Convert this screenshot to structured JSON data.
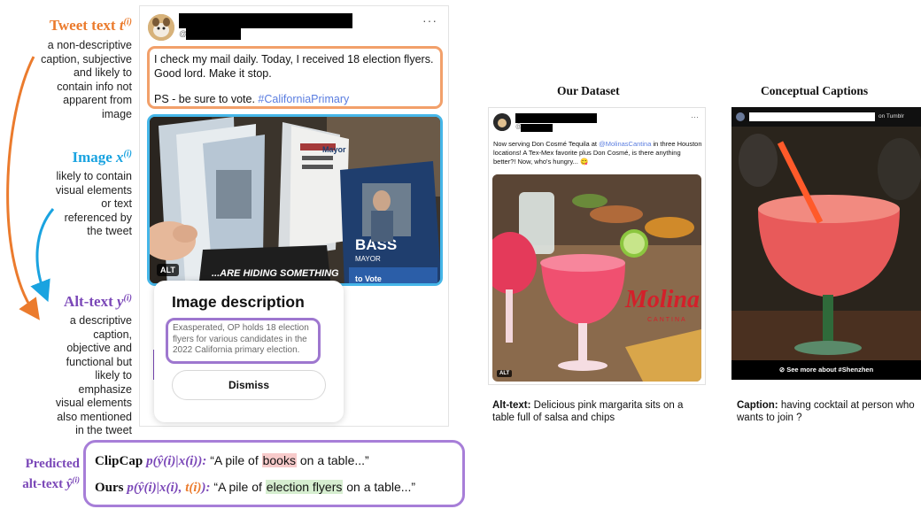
{
  "labels": {
    "tweet_text": {
      "title_prefix": "Tweet text",
      "symbol": "t",
      "superscript": "(i)",
      "description": "a non-descriptive caption, subjective and likely to contain info not apparent from image"
    },
    "image": {
      "title_prefix": "Image",
      "symbol": "x",
      "superscript": "(i)",
      "description": "likely to contain visual elements or text referenced by the tweet"
    },
    "alt_text": {
      "title_prefix": "Alt-text",
      "symbol": "y",
      "superscript": "(i)",
      "description": "a descriptive caption, objective and functional but likely to emphasize visual elements also mentioned in the tweet"
    },
    "predicted": {
      "line1": "Predicted",
      "line2": "alt-text",
      "symbol": "ŷ",
      "superscript": "(i)"
    }
  },
  "tweet": {
    "handle": "@",
    "more": "···",
    "text_line1": "I check my mail daily. Today, I received 18 election flyers.  Good lord. Make it stop.",
    "text_line2": "PS - be sure to vote. ",
    "hashtag": "#CaliforniaPrimary",
    "alt_badge": "ALT",
    "image_texts": [
      "...ARE HIDING SOMETHING",
      "BASS",
      "MAYOR",
      "to Vote",
      "Mayor"
    ]
  },
  "popup": {
    "title": "Image description",
    "description": "Exasperated, OP holds 18 election flyers for various candidates in the 2022 California primary election.",
    "dismiss": "Dismiss"
  },
  "predictions": {
    "clipcap": {
      "model": "ClipCap",
      "formula": "p(ŷ(i)|x(i)):",
      "quote_open": "“A pile of ",
      "highlight": "books",
      "quote_close": " on a table...”"
    },
    "ours": {
      "model": "Ours",
      "formula_a": "p(ŷ(i)|x(i), ",
      "formula_t": "t(i)",
      "formula_b": "):",
      "quote_open": "“A pile of ",
      "highlight": "election flyers",
      "quote_close": " on a table...”"
    }
  },
  "our_dataset": {
    "title": "Our Dataset",
    "handle": "@",
    "more": "···",
    "text_a": "Now serving Don Cosmé Tequila at ",
    "mention": "@MolinasCantina",
    "text_b": " in three Houston locations!  A Tex-Mex favorite plus Don Cosmé, is there anything better?!  Now, who's hungry... 😋",
    "brand": "Molina's",
    "brand_sub": "CANTINA",
    "alt_badge": "ALT",
    "caption_label": "Alt-text:",
    "caption": " Delicious pink margarita sits on a table full of salsa and chips"
  },
  "conceptual_captions": {
    "title": "Conceptual Captions",
    "source": "on Tumblr",
    "see_more": "⊘ See more about #Shenzhen",
    "caption_label": "Caption:",
    "caption": " having cocktail at person who wants to join ?"
  },
  "colors": {
    "tweet": "#EB7B2D",
    "image": "#1AA3E0",
    "alt_text": "#7B48B8"
  }
}
